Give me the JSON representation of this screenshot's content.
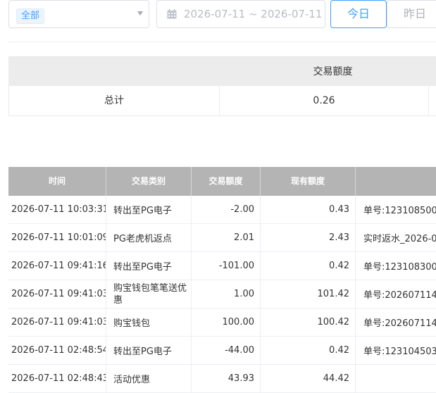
{
  "filters": {
    "category_tag": "全部",
    "date_range": "2026-07-11 ~ 2026-07-11",
    "today_label": "今日",
    "yesterday_label": "昨日"
  },
  "summary": {
    "header": "交易额度",
    "row_label": "总计",
    "value": "0.26"
  },
  "table": {
    "headers": [
      "时间",
      "交易类别",
      "交易额度",
      "现有额度",
      ""
    ],
    "rows": [
      {
        "time": "2026-07-11 10:03:31",
        "type": "转出至PG电子",
        "amount": "-2.00",
        "balance": "0.43",
        "note": "单号:123108500"
      },
      {
        "time": "2026-07-11 10:01:09",
        "type": "PG老虎机返点",
        "amount": "2.01",
        "balance": "2.43",
        "note": "实时返水_2026-0"
      },
      {
        "time": "2026-07-11 09:41:16",
        "type": "转出至PG电子",
        "amount": "-101.00",
        "balance": "0.42",
        "note": "单号:123108300"
      },
      {
        "time": "2026-07-11 09:41:03",
        "type": "购宝钱包笔笔送优惠",
        "amount": "1.00",
        "balance": "101.42",
        "note": "单号:202607114"
      },
      {
        "time": "2026-07-11 09:41:03",
        "type": "购宝钱包",
        "amount": "100.00",
        "balance": "100.42",
        "note": "单号:202607114"
      },
      {
        "time": "2026-07-11 02:48:54",
        "type": "转出至PG电子",
        "amount": "-44.00",
        "balance": "0.42",
        "note": "单号:123104503"
      },
      {
        "time": "2026-07-11 02:48:43",
        "type": "活动优惠",
        "amount": "43.93",
        "balance": "44.42",
        "note": ""
      }
    ]
  }
}
